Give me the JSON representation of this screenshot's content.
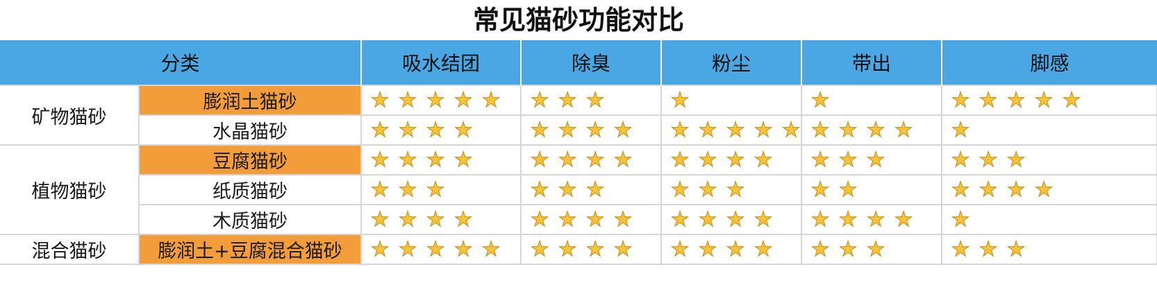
{
  "title": "常见猫砂功能对比",
  "colors": {
    "header_bg": "#4aa7e4",
    "highlight_bg": "#f39c3a",
    "star": "#f6c43a"
  },
  "headers": {
    "category": "分类",
    "columns": [
      "吸水结团",
      "除臭",
      "粉尘",
      "带出",
      "脚感"
    ]
  },
  "groups": [
    {
      "name": "矿物猫砂",
      "rows": [
        {
          "name": "膨润土猫砂",
          "highlight": true,
          "ratings": [
            5,
            3,
            1,
            1,
            5
          ]
        },
        {
          "name": "水晶猫砂",
          "highlight": false,
          "ratings": [
            4,
            4,
            5,
            4,
            1
          ]
        }
      ]
    },
    {
      "name": "植物猫砂",
      "rows": [
        {
          "name": "豆腐猫砂",
          "highlight": true,
          "ratings": [
            4,
            4,
            4,
            3,
            3
          ]
        },
        {
          "name": "纸质猫砂",
          "highlight": false,
          "ratings": [
            3,
            3,
            3,
            2,
            4
          ]
        },
        {
          "name": "木质猫砂",
          "highlight": false,
          "ratings": [
            4,
            4,
            4,
            4,
            1
          ]
        }
      ]
    },
    {
      "name": "混合猫砂",
      "rows": [
        {
          "name": "膨润土+豆腐混合猫砂",
          "highlight": true,
          "ratings": [
            5,
            4,
            4,
            3,
            3
          ]
        }
      ]
    }
  ],
  "icons": {
    "rating": "star-icon"
  }
}
